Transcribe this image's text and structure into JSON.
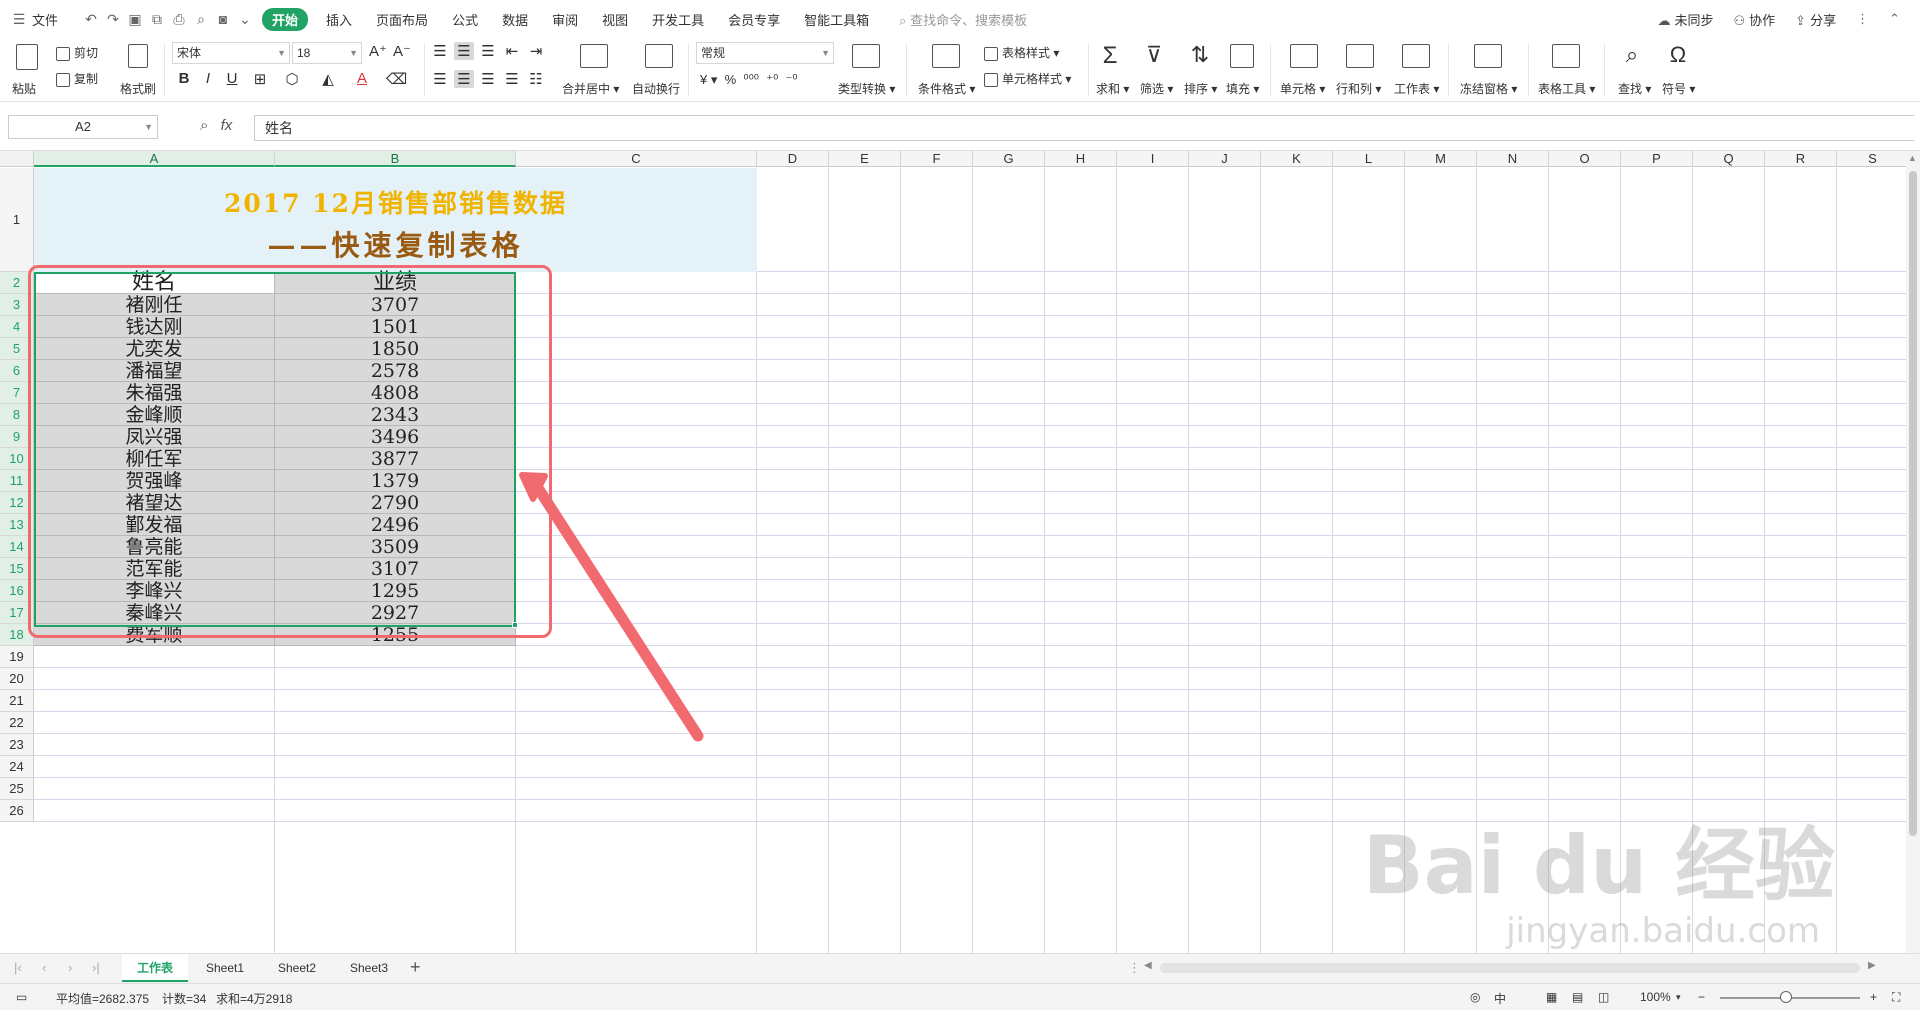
{
  "menu": {
    "file": "文件",
    "tabs": [
      "开始",
      "插入",
      "页面布局",
      "公式",
      "数据",
      "审阅",
      "视图",
      "开发工具",
      "会员专享",
      "智能工具箱"
    ],
    "search_placeholder": "查找命令、搜索模板",
    "right": {
      "sync": "未同步",
      "collab": "协作",
      "share": "分享"
    }
  },
  "ribbon": {
    "paste": "粘贴",
    "cut": "剪切",
    "copy": "复制",
    "format_painter": "格式刷",
    "font_name": "宋体",
    "font_size": "18",
    "merge_center": "合并居中",
    "wrap": "自动换行",
    "number_format": "常规",
    "type_convert": "类型转换",
    "cond_format": "条件格式",
    "table_style": "表格样式",
    "cell_style": "单元格样式",
    "sum": "求和",
    "filter": "筛选",
    "sort": "排序",
    "fill": "填充",
    "cell": "单元格",
    "row_col": "行和列",
    "worksheet": "工作表",
    "freeze": "冻结窗格",
    "table_tools": "表格工具",
    "find": "查找",
    "symbol": "符号"
  },
  "formula_bar": {
    "cell_ref": "A2",
    "fx": "fx",
    "content": "姓名"
  },
  "columns": [
    "A",
    "B",
    "C",
    "D",
    "E",
    "F",
    "G",
    "H",
    "I",
    "J",
    "K",
    "L",
    "M",
    "N",
    "O",
    "P",
    "Q",
    "R",
    "S"
  ],
  "rows": [
    "1",
    "2",
    "3",
    "4",
    "5",
    "6",
    "7",
    "8",
    "9",
    "10",
    "11",
    "12",
    "13",
    "14",
    "15",
    "16",
    "17",
    "18",
    "19",
    "20",
    "21",
    "22",
    "23",
    "24",
    "25",
    "26"
  ],
  "sheet": {
    "title_line1": "2017 12月销售部销售数据",
    "title_line2": "——快速复制表格",
    "header": [
      "姓名",
      "业绩"
    ],
    "data": [
      [
        "褚刚任",
        "3707"
      ],
      [
        "钱达刚",
        "1501"
      ],
      [
        "尤奕发",
        "1850"
      ],
      [
        "潘福望",
        "2578"
      ],
      [
        "朱福强",
        "4808"
      ],
      [
        "金峰顺",
        "2343"
      ],
      [
        "凤兴强",
        "3496"
      ],
      [
        "柳任军",
        "3877"
      ],
      [
        "贺强峰",
        "1379"
      ],
      [
        "褚望达",
        "2790"
      ],
      [
        "鄞发福",
        "2496"
      ],
      [
        "鲁亮能",
        "3509"
      ],
      [
        "范军能",
        "3107"
      ],
      [
        "李峰兴",
        "1295"
      ],
      [
        "秦峰兴",
        "2927"
      ],
      [
        "费军顺",
        "1255"
      ]
    ]
  },
  "sheet_tabs": [
    "工作表",
    "Sheet1",
    "Sheet2",
    "Sheet3"
  ],
  "status": {
    "average": "平均值=2682.375",
    "count": "计数=34",
    "sum": "求和=4万2918",
    "lang": "中",
    "zoom": "100%"
  },
  "watermark": {
    "main": "Bai du 经验",
    "sub": "jingyan.baidu.com"
  },
  "colors": {
    "accent": "#21a366",
    "title_yellow": "#f0b400",
    "title_brown": "#9a5a12",
    "annotation": "#f16a6f"
  }
}
